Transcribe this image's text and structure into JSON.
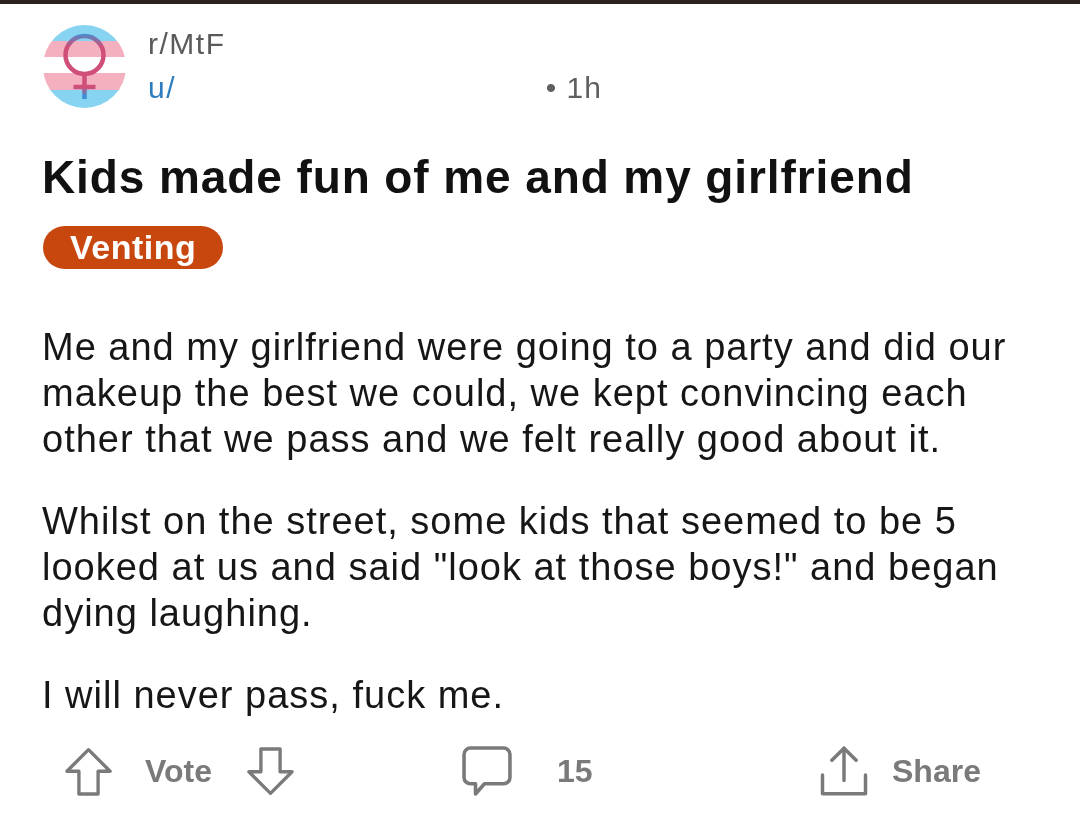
{
  "post": {
    "community": "r/MtF",
    "author_prefix": "u/",
    "separator": "•",
    "time": "1h",
    "title": "Kids made fun of me and my girlfriend",
    "flair": "Venting",
    "paragraphs": [
      "Me and my girlfriend were going to a party and did our makeup the best we could, we kept convincing each other that we pass and we felt really good about it.",
      "Whilst on the street, some kids that seemed to be 5 looked at us and said \"look at those boys!\" and began dying laughing.",
      "I will never pass, fuck me."
    ]
  },
  "actions": [
    {
      "kind": "vote",
      "label": "Vote"
    },
    {
      "kind": "comments",
      "label": "15"
    },
    {
      "kind": "share",
      "label": "Share"
    }
  ]
}
